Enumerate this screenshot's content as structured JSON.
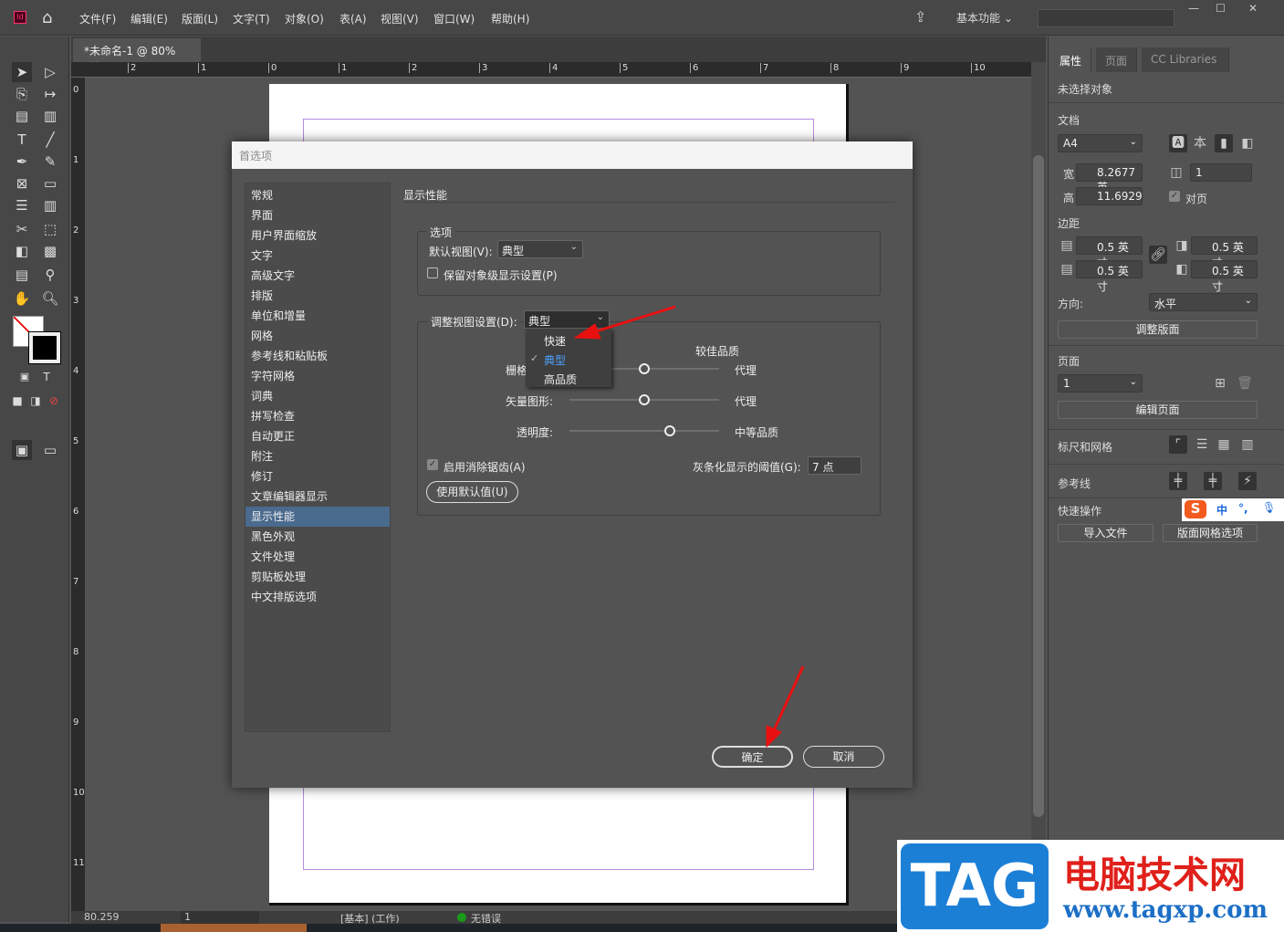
{
  "app": {
    "logo": "Id",
    "menus": [
      "文件(F)",
      "编辑(E)",
      "版面(L)",
      "文字(T)",
      "对象(O)",
      "表(A)",
      "视图(V)",
      "窗口(W)",
      "帮助(H)"
    ],
    "workspace": "基本功能",
    "window_controls": [
      "—",
      "☐",
      "✕"
    ]
  },
  "document_tab": {
    "title": "*未命名-1 @ 80%",
    "close": "×"
  },
  "ruler": {
    "h_ticks": [
      "2",
      "1",
      "0",
      "1",
      "2",
      "3",
      "4",
      "5",
      "6",
      "7",
      "8",
      "9",
      "10"
    ],
    "v_ticks": [
      "0",
      "1",
      "2",
      "3",
      "4",
      "5",
      "6",
      "7",
      "8",
      "9",
      "10",
      "11"
    ]
  },
  "status": {
    "zoom": "80.259",
    "page": "1",
    "style": "[基本] (工作)",
    "errors": "无错误"
  },
  "right_panel": {
    "tabs": [
      "属性",
      "页面",
      "CC Libraries"
    ],
    "selection": "未选择对象",
    "doc_label": "文档",
    "page_size": "A4",
    "width_label": "宽",
    "width": "8.2677 英",
    "height_label": "高",
    "height": "11.6929",
    "pages_count": "1",
    "facing_pages": "对页",
    "margins_label": "边距",
    "margin_top": "0.5 英寸",
    "margin_bottom": "0.5 英寸",
    "margin_left": "0.5 英寸",
    "margin_right": "0.5 英寸",
    "orientation_label": "方向:",
    "orientation": "水平",
    "adjust_layout": "调整版面",
    "pages_label": "页面",
    "page": "1",
    "edit_page": "编辑页面",
    "rulers_grids": "标尺和网格",
    "guides": "参考线",
    "quick_actions": "快速操作",
    "import_file": "导入文件",
    "layout_grid": "版面网格选项",
    "ime": {
      "lang": "中",
      "punct": "°,"
    }
  },
  "dialog": {
    "title": "首选项",
    "categories": [
      "常规",
      "界面",
      "用户界面缩放",
      "文字",
      "高级文字",
      "排版",
      "单位和增量",
      "网格",
      "参考线和粘贴板",
      "字符网格",
      "词典",
      "拼写检查",
      "自动更正",
      "附注",
      "修订",
      "文章编辑器显示",
      "显示性能",
      "黑色外观",
      "文件处理",
      "剪贴板处理",
      "中文排版选项"
    ],
    "selected_category": 16,
    "section_title": "显示性能",
    "options_group": "选项",
    "default_view_label": "默认视图(V):",
    "default_view": "典型",
    "preserve_label": "保留对象级显示设置(P)",
    "preserve_checked": false,
    "adjust_label": "调整视图设置(D):",
    "adjust_value": "典型",
    "dropdown_options": [
      "快速",
      "典型",
      "高品质"
    ],
    "dropdown_selected": 1,
    "better_quality": "较佳品质",
    "raster_label": "栅格",
    "raster_value": "代理",
    "raster_level": 0.5,
    "vector_label": "矢量图形:",
    "vector_value": "代理",
    "vector_level": 0.5,
    "transparency_label": "透明度:",
    "transparency_value": "中等品质",
    "transparency_level": 0.67,
    "antialias_label": "启用消除锯齿(A)",
    "antialias_checked": true,
    "greek_label": "灰条化显示的阈值(G):",
    "greek_value": "7 点",
    "defaults_button": "使用默认值(U)",
    "ok": "确定",
    "cancel": "取消"
  },
  "watermark": {
    "tag": "TAG",
    "site_name": "电脑技术网",
    "url": "www.tagxp.com"
  },
  "colors": {
    "accent": "#4a6a8e",
    "arrow": "#e81010",
    "selected_option": "#4ea3ff"
  }
}
